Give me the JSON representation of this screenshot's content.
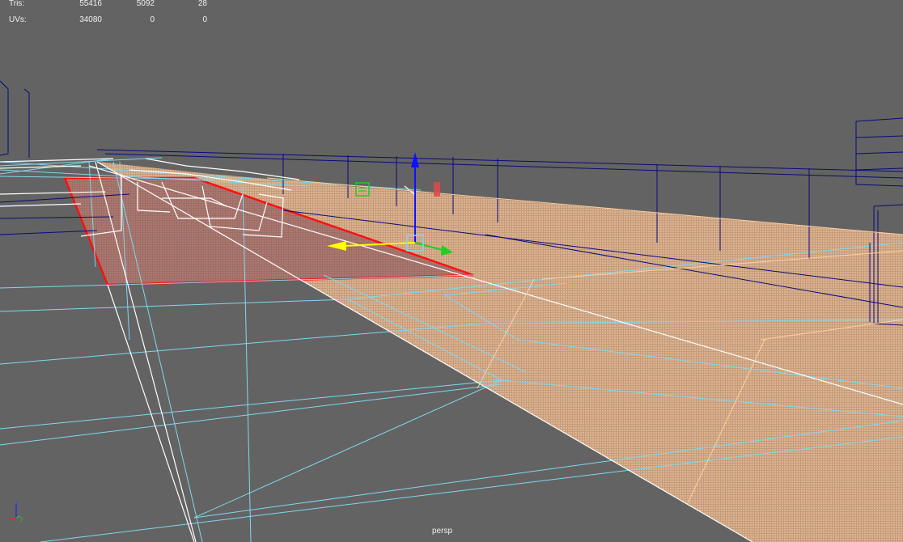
{
  "hud": {
    "rows": [
      {
        "label": "Tris:",
        "v1": "55416",
        "v2": "5092",
        "v3": "28"
      },
      {
        "label": "UVs:",
        "v1": "34080",
        "v2": "0",
        "v3": "0"
      }
    ]
  },
  "camera": {
    "name": "persp"
  },
  "axes": {
    "z": "z",
    "y": "y",
    "x": "x"
  },
  "colors": {
    "background": "#636363",
    "wire_cyan": "#7fd8f0",
    "wire_navy": "#0a0a7a",
    "wire_white": "#ffffff",
    "selection_red": "#ff1010",
    "surface_peach": "#e7b48a",
    "manip_y": "#1010ff",
    "manip_x": "#ffff00",
    "manip_z": "#22cc22"
  },
  "icons": {
    "move_manipulator": "move-manipulator-icon",
    "axis_triad": "axis-triad-icon"
  }
}
